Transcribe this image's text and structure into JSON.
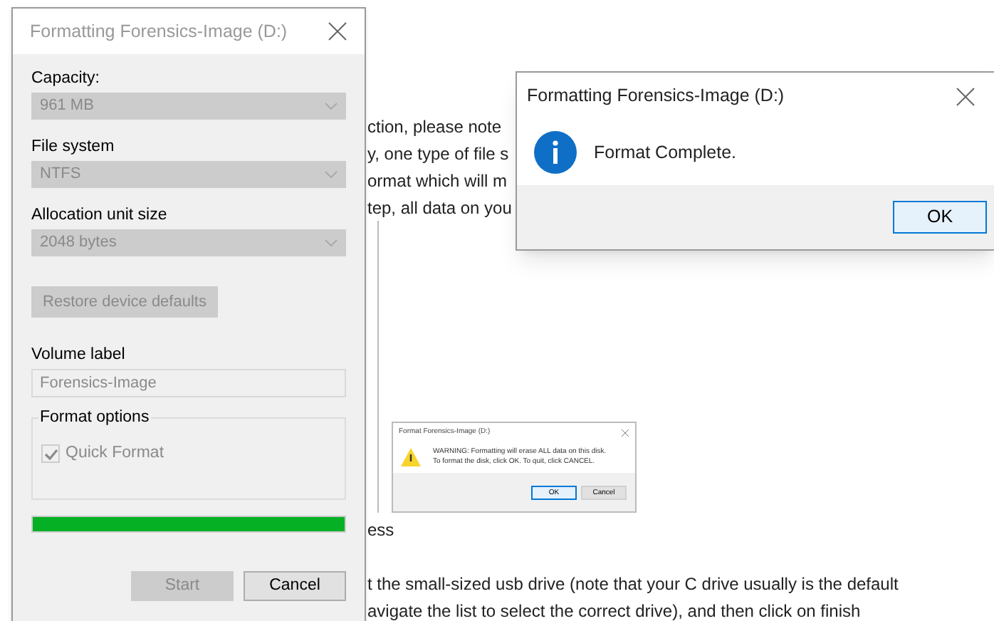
{
  "document": {
    "lines_top": [
      "ction, please note",
      "y, one type of file s",
      "ormat which will m",
      "tep, all data on you"
    ],
    "lines_bottom": [
      "ess",
      "t the small-sized usb drive (note that your C drive usually is the default",
      "avigate the list to select the correct drive), and then click on finish"
    ]
  },
  "format_dialog": {
    "title": "Formatting Forensics-Image (D:)",
    "fields": [
      {
        "label": "Capacity:",
        "value": "961 MB",
        "disabled": true
      },
      {
        "label": "File system",
        "value": "NTFS",
        "disabled": true
      },
      {
        "label": "Allocation unit size",
        "value": "2048 bytes",
        "disabled": true
      }
    ],
    "restore_button": {
      "label": "Restore device defaults",
      "disabled": true
    },
    "volume_label": {
      "label": "Volume label",
      "value": "Forensics-Image",
      "disabled": true
    },
    "format_options": {
      "title": "Format options",
      "quick_format": {
        "label": "Quick Format",
        "checked": true,
        "disabled": true
      }
    },
    "progress": {
      "level": 1
    },
    "buttons": [
      {
        "label": "Start",
        "disabled": true
      },
      {
        "label": "Cancel",
        "disabled": false
      }
    ]
  },
  "warning_screenshot": {
    "title": "Format Forensics-Image (D:)",
    "message_lines": [
      "WARNING: Formatting will erase ALL data on this disk.",
      "To format the disk, click OK. To quit, click CANCEL."
    ],
    "buttons": [
      {
        "label": "OK",
        "selected": true
      },
      {
        "label": "Cancel",
        "selected": false
      }
    ]
  },
  "complete_dialog": {
    "title": "Formatting Forensics-Image (D:)",
    "message": "Format Complete.",
    "button": {
      "label": "OK",
      "selected": true
    }
  }
}
